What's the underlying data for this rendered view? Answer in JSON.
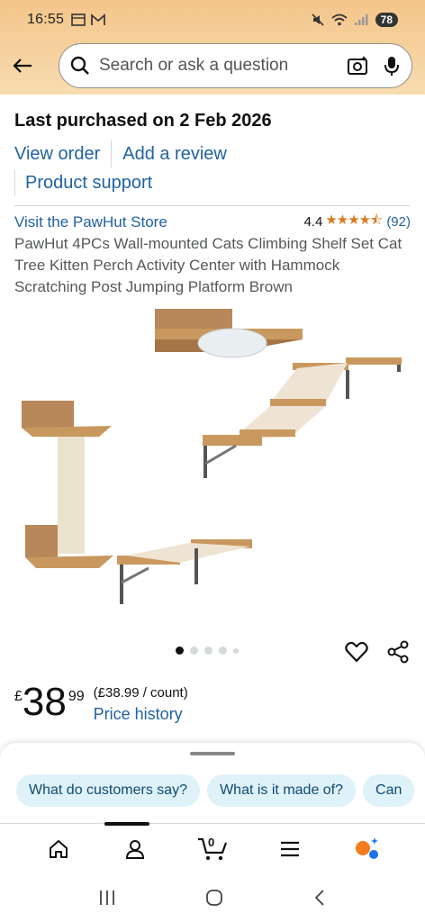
{
  "status": {
    "time": "16:55",
    "battery": "78"
  },
  "search": {
    "placeholder": "Search or ask a question"
  },
  "order": {
    "title": "Last purchased on 2 Feb 2026",
    "view_order": "View order",
    "add_review": "Add a review",
    "product_support": "Product support"
  },
  "product": {
    "store": "Visit the PawHut Store",
    "rating_value": "4.4",
    "stars": "★★★★⯪",
    "rating_count": "(92)",
    "title": "PawHut 4PCs Wall-mounted Cats Climbing Shelf Set Cat Tree Kitten Perch Activity Center with Hammock Scratching Post Jumping Platform Brown"
  },
  "price": {
    "symbol": "£",
    "whole": "38",
    "fraction": "99",
    "unit_price": "(£38.99 / count)",
    "history_label": "Price history"
  },
  "sheet": {
    "chips": [
      "What do customers say?",
      "What is it made of?",
      "Can"
    ]
  },
  "nav": {
    "cart_count": "0"
  },
  "colors": {
    "link": "#2162a1",
    "star": "#de7921",
    "header_top": "#f3c58a",
    "chip_bg": "#dff1f9"
  },
  "icons": [
    "back-arrow-icon",
    "search-icon",
    "camera-icon",
    "microphone-icon",
    "heart-icon",
    "share-icon",
    "home-icon",
    "account-icon",
    "cart-icon",
    "menu-icon",
    "rufus-icon",
    "recent-apps-icon",
    "home-circle-icon",
    "back-chevron-icon"
  ]
}
